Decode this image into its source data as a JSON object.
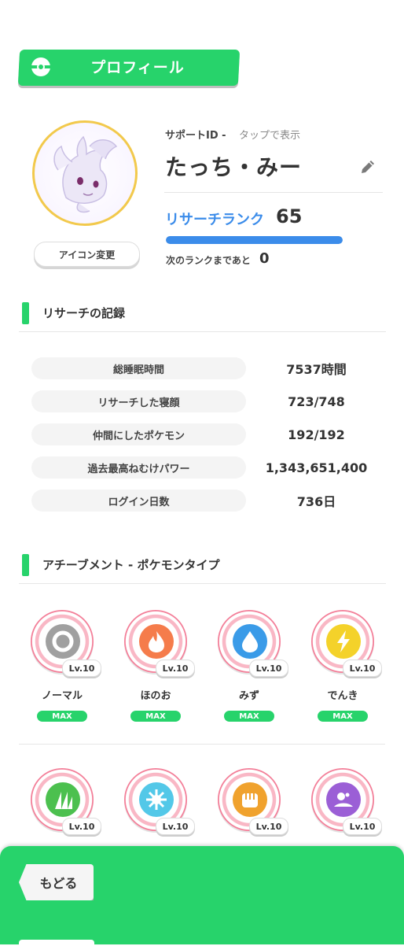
{
  "header": {
    "title": "プロフィール",
    "icon": "pokeball-icon"
  },
  "profile": {
    "icon_change_label": "アイコン変更",
    "support_id_label": "サポートID -",
    "support_id_tap": "タップで表示",
    "name": "たっち・みー",
    "research_rank_label": "リサーチランク",
    "research_rank_value": "65",
    "rank_progress": 1.0,
    "next_rank_label": "次のランクまであと",
    "next_rank_value": "0"
  },
  "records": {
    "title": "リサーチの記録",
    "rows": [
      {
        "label": "総睡眠時間",
        "value": "7537時間"
      },
      {
        "label": "リサーチした寝顔",
        "value": "723/748"
      },
      {
        "label": "仲間にしたポケモン",
        "value": "192/192"
      },
      {
        "label": "過去最高ねむけパワー",
        "value": "1,343,651,400"
      },
      {
        "label": "ログイン日数",
        "value": "736日"
      }
    ]
  },
  "achievements": {
    "title": "アチーブメント - ポケモンタイプ",
    "items": [
      {
        "name": "ノーマル",
        "level": "Lv.10",
        "badge": "MAX",
        "color": "#a0a0a0",
        "icon": "normal-type-icon"
      },
      {
        "name": "ほのお",
        "level": "Lv.10",
        "badge": "MAX",
        "color": "#f57c4b",
        "icon": "fire-type-icon"
      },
      {
        "name": "みず",
        "level": "Lv.10",
        "badge": "MAX",
        "color": "#3a9be8",
        "icon": "water-type-icon"
      },
      {
        "name": "でんき",
        "level": "Lv.10",
        "badge": "MAX",
        "color": "#f4d22a",
        "icon": "electric-type-icon"
      },
      {
        "level": "Lv.10",
        "color": "#4cc04f",
        "icon": "grass-type-icon"
      },
      {
        "level": "Lv.10",
        "color": "#53c8e8",
        "icon": "ice-type-icon"
      },
      {
        "level": "Lv.10",
        "color": "#f0a22d",
        "icon": "fighting-type-icon"
      },
      {
        "level": "Lv.10",
        "color": "#9b5fd6",
        "icon": "poison-type-icon"
      }
    ]
  },
  "footer": {
    "back_label": "もどる"
  }
}
